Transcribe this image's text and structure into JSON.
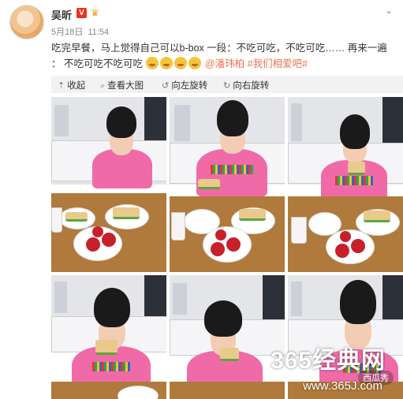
{
  "user": {
    "name": "吴昕",
    "verified_badge": "V",
    "crown_icon": "crown-icon"
  },
  "meta": {
    "date": "5月18日",
    "time": "11:54"
  },
  "post": {
    "line1": "吃完早餐，马上觉得自己可以b-box 一段：不吃可吃，不吃可吃…… 再来一遍 ： 不吃可吃不吃可吃",
    "emoji_count": 4,
    "mention": "@潘玮柏",
    "hashtag": "#我们相爱吧#"
  },
  "toolbar": {
    "collapse": "收起",
    "view_large": "查看大图",
    "rotate_left": "向左旋转",
    "rotate_right": "向右旋转"
  },
  "watermark": {
    "brand": "365经典网",
    "url": "www.365J.com",
    "badge": "西瓜秀"
  },
  "colors": {
    "link": "#eb7350",
    "verified": "#e8341c",
    "toolbar_bg": "#f2f2f5"
  }
}
